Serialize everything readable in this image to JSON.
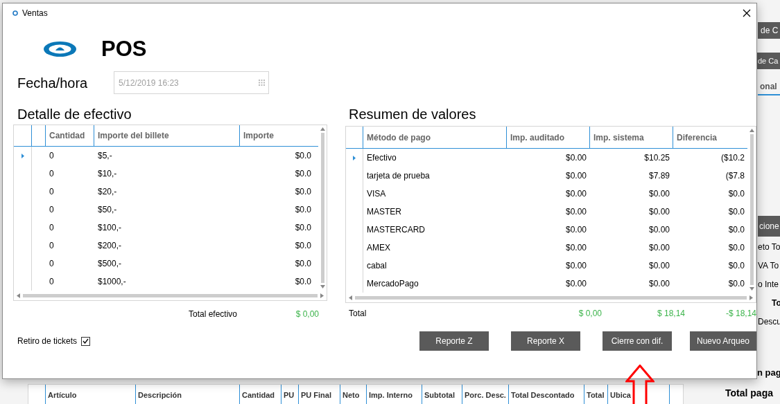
{
  "background_app": {
    "side_buttons": [
      "de C",
      "de Ca"
    ],
    "side_tab": "onal",
    "side_section": "cione",
    "side_labels": [
      {
        "text": "eto To",
        "bold": false
      },
      {
        "text": "VA To",
        "bold": false
      },
      {
        "text": "o Inte",
        "bold": false
      },
      {
        "text": "To",
        "bold": true
      },
      {
        "text": "Descu",
        "bold": false
      }
    ],
    "totals": [
      "n pag",
      "Total paga"
    ],
    "table_columns": [
      "Artículo",
      "Descripción",
      "Cantidad",
      "PU",
      "PU Final",
      "Neto",
      "Imp. Interno",
      "Subtotal",
      "Porc. Desc.",
      "Total Descontado",
      "Total",
      "Ubica"
    ]
  },
  "dialog": {
    "title": "Ventas",
    "logo_text": "POS",
    "date": {
      "label": "Fecha/hora",
      "value": "5/12/2019 16:23"
    },
    "cash": {
      "title": "Detalle de efectivo",
      "columns": [
        "Cantidad",
        "Importe del billete",
        "Importe"
      ],
      "rows": [
        {
          "selected": true,
          "cells": [
            "0",
            "$5,-",
            "$0.0"
          ]
        },
        {
          "selected": false,
          "cells": [
            "0",
            "$10,-",
            "$0.0"
          ]
        },
        {
          "selected": false,
          "cells": [
            "0",
            "$20,-",
            "$0.0"
          ]
        },
        {
          "selected": false,
          "cells": [
            "0",
            "$50,-",
            "$0.0"
          ]
        },
        {
          "selected": false,
          "cells": [
            "0",
            "$100,-",
            "$0.0"
          ]
        },
        {
          "selected": false,
          "cells": [
            "0",
            "$200,-",
            "$0.0"
          ]
        },
        {
          "selected": false,
          "cells": [
            "0",
            "$500,-",
            "$0.0"
          ]
        },
        {
          "selected": false,
          "cells": [
            "0",
            "$1000,-",
            "$0.0"
          ]
        }
      ],
      "total_label": "Total efectivo",
      "total_value": "$ 0,00"
    },
    "summary": {
      "title": "Resumen de valores",
      "columns": [
        "Método de pago",
        "Imp. auditado",
        "Imp. sistema",
        "Diferencia"
      ],
      "rows": [
        {
          "selected": true,
          "cells": [
            "Efectivo",
            "$0.00",
            "$10.25",
            "($10.2"
          ]
        },
        {
          "selected": false,
          "cells": [
            "tarjeta de prueba",
            "$0.00",
            "$7.89",
            "($7.8"
          ]
        },
        {
          "selected": false,
          "cells": [
            "VISA",
            "$0.00",
            "$0.00",
            "$0.0"
          ]
        },
        {
          "selected": false,
          "cells": [
            "MASTER",
            "$0.00",
            "$0.00",
            "$0.0"
          ]
        },
        {
          "selected": false,
          "cells": [
            "MASTERCARD",
            "$0.00",
            "$0.00",
            "$0.0"
          ]
        },
        {
          "selected": false,
          "cells": [
            "AMEX",
            "$0.00",
            "$0.00",
            "$0.0"
          ]
        },
        {
          "selected": false,
          "cells": [
            "cabal",
            "$0.00",
            "$0.00",
            "$0.0"
          ]
        },
        {
          "selected": false,
          "cells": [
            "MercadoPago",
            "$0.00",
            "$0.00",
            "$0.0"
          ]
        }
      ],
      "total_label": "Total",
      "totals": [
        "$ 0,00",
        "$ 18,14",
        "-$ 18,14"
      ]
    },
    "retiro": {
      "label": "Retiro de tickets",
      "checked": true
    },
    "buttons": [
      "Reporte Z",
      "Reporte X",
      "Cierre con dif.",
      "Nuevo Arqueo"
    ]
  }
}
